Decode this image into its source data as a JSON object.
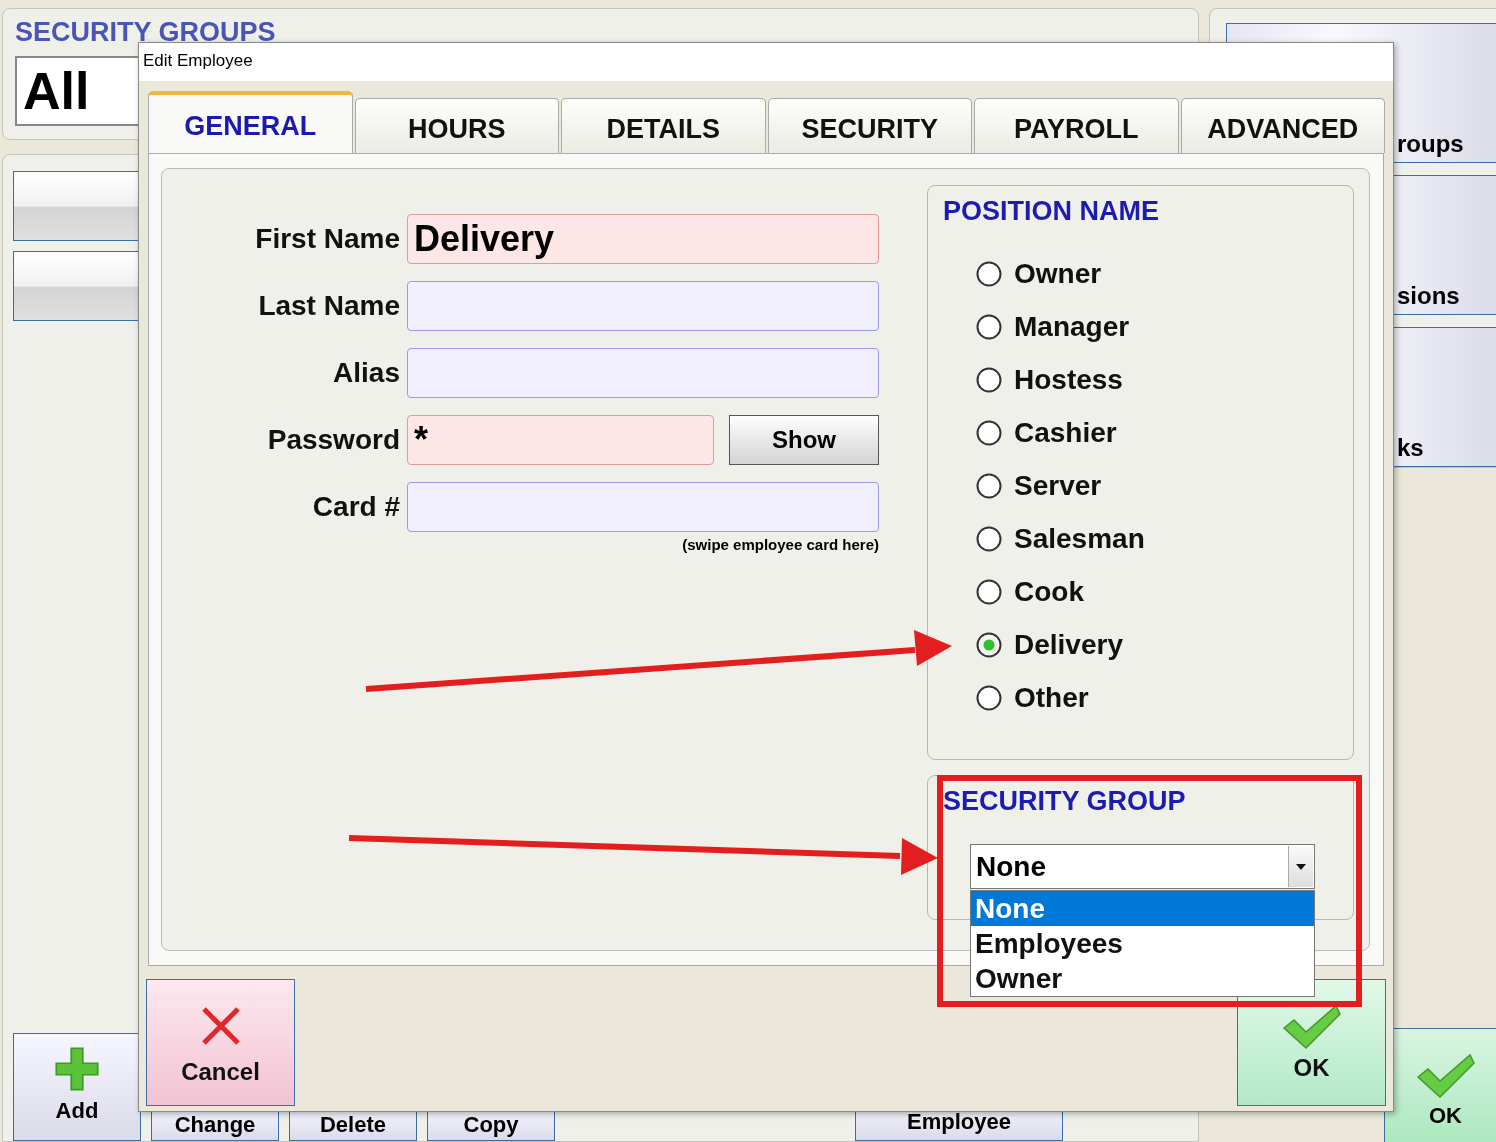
{
  "background": {
    "groups_label": "SECURITY GROUPS",
    "group_field": "All",
    "side_buttons": [
      "roups",
      "sions",
      "ks"
    ],
    "add_button": "Add",
    "bottom_buttons": [
      "Change",
      "Delete",
      "Copy"
    ],
    "employee_button": "Employee",
    "ok_button": "OK"
  },
  "dialog": {
    "title": "Edit Employee",
    "tabs": [
      {
        "label": "GENERAL",
        "selected": true
      },
      {
        "label": "HOURS",
        "selected": false
      },
      {
        "label": "DETAILS",
        "selected": false
      },
      {
        "label": "SECURITY",
        "selected": false
      },
      {
        "label": "PAYROLL",
        "selected": false
      },
      {
        "label": "ADVANCED",
        "selected": false
      }
    ],
    "fields": [
      {
        "label": "First Name",
        "value": "Delivery",
        "required": true
      },
      {
        "label": "Last Name",
        "required": false
      },
      {
        "label": "Alias",
        "required": false
      },
      {
        "label": "Password",
        "value": "*",
        "required": true,
        "button": "Show"
      },
      {
        "label": "Card #",
        "required": false,
        "hint": "(swipe employee card here)"
      }
    ],
    "position": {
      "title": "POSITION NAME",
      "options": [
        {
          "label": "Owner",
          "selected": false
        },
        {
          "label": "Manager",
          "selected": false
        },
        {
          "label": "Hostess",
          "selected": false
        },
        {
          "label": "Cashier",
          "selected": false
        },
        {
          "label": "Server",
          "selected": false
        },
        {
          "label": "Salesman",
          "selected": false
        },
        {
          "label": "Cook",
          "selected": false
        },
        {
          "label": "Delivery",
          "selected": true
        },
        {
          "label": "Other",
          "selected": false
        }
      ]
    },
    "security_group": {
      "title": "SECURITY GROUP",
      "value": "None",
      "expanded": true,
      "options": [
        {
          "label": "None",
          "selected": true
        },
        {
          "label": "Employees",
          "selected": false
        },
        {
          "label": "Owner",
          "selected": false
        }
      ]
    },
    "cancel_button": "Cancel",
    "ok_button": "OK"
  }
}
